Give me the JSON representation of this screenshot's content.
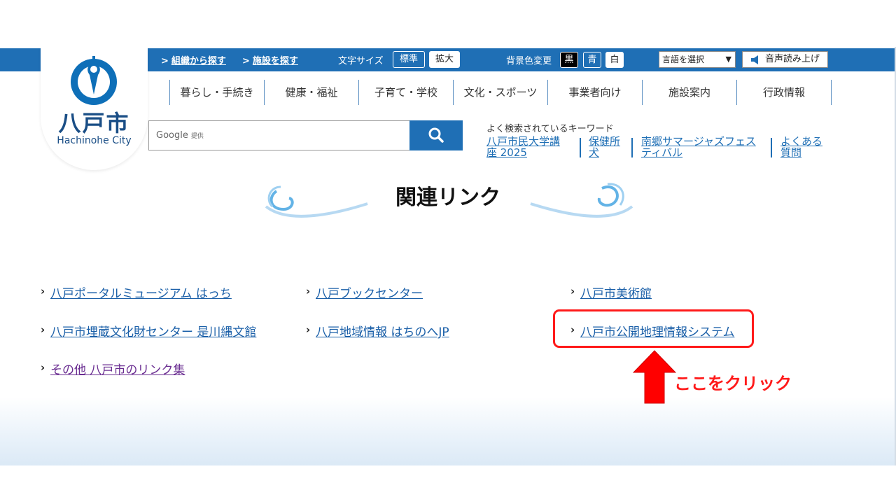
{
  "header": {
    "logo_jp": "八戸市",
    "logo_en": "Hachinohe City",
    "top_links": [
      "組織から探す",
      "施設を探す"
    ],
    "font_size_label": "文字サイズ",
    "font_size_buttons": [
      "標準",
      "拡大"
    ],
    "bg_color_label": "背景色変更",
    "bg_color_buttons": [
      "黒",
      "青",
      "白"
    ],
    "language_select": "言語を選択",
    "read_aloud": "音声読み上げ",
    "colors": {
      "primary": "#1f6fb5"
    }
  },
  "nav": {
    "items": [
      "暮らし・手続き",
      "健康・福祉",
      "子育て・学校",
      "文化・スポーツ",
      "事業者向け",
      "施設案内",
      "行政情報"
    ]
  },
  "search": {
    "brand": "Google",
    "brand_sub": "提供",
    "keywords_title": "よく検索されているキーワード",
    "keywords": [
      [
        "八戸市民大学講",
        "座 2025"
      ],
      [
        "保健所",
        "犬"
      ],
      [
        "南郷サマージャズフェス",
        "ティバル"
      ],
      [
        "よくある",
        "質問"
      ]
    ]
  },
  "page": {
    "title": "関連リンク",
    "links": [
      "八戸ポータルミュージアム はっち",
      "八戸ブックセンター",
      "八戸市美術館",
      "八戸市埋蔵文化財センター 是川縄文館",
      "八戸地域情報 はちのへJP",
      "八戸市公開地理情報システム",
      "その他 八戸市のリンク集"
    ]
  },
  "annotation": {
    "text": "ここをクリック",
    "color": "#ff1a1a"
  }
}
